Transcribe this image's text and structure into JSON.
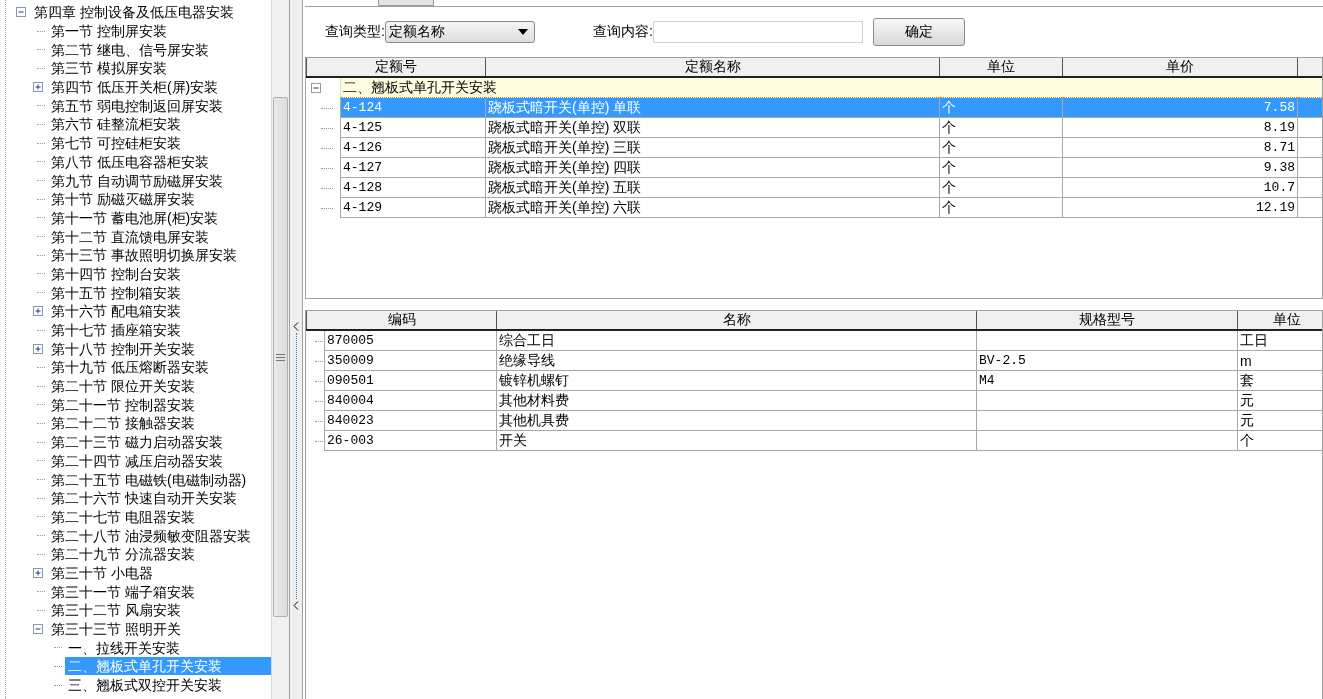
{
  "tree": {
    "items": [
      {
        "label": "第四章 控制设备及低压电器安装",
        "kind": "folder",
        "expanded": true,
        "selected": false,
        "children": [
          {
            "label": "第一节 控制屏安装",
            "kind": "leaf",
            "selected": false
          },
          {
            "label": "第二节 继电、信号屏安装",
            "kind": "leaf",
            "selected": false
          },
          {
            "label": "第三节 模拟屏安装",
            "kind": "leaf",
            "selected": false
          },
          {
            "label": "第四节 低压开关柜(屏)安装",
            "kind": "folder",
            "expanded": false,
            "selected": false
          },
          {
            "label": "第五节 弱电控制返回屏安装",
            "kind": "leaf",
            "selected": false
          },
          {
            "label": "第六节 硅整流柜安装",
            "kind": "leaf",
            "selected": false
          },
          {
            "label": "第七节 可控硅柜安装",
            "kind": "leaf",
            "selected": false
          },
          {
            "label": "第八节 低压电容器柜安装",
            "kind": "leaf",
            "selected": false
          },
          {
            "label": "第九节 自动调节励磁屏安装",
            "kind": "leaf",
            "selected": false
          },
          {
            "label": "第十节 励磁灭磁屏安装",
            "kind": "leaf",
            "selected": false
          },
          {
            "label": "第十一节 蓄电池屏(柜)安装",
            "kind": "leaf",
            "selected": false
          },
          {
            "label": "第十二节 直流馈电屏安装",
            "kind": "leaf",
            "selected": false
          },
          {
            "label": "第十三节 事故照明切换屏安装",
            "kind": "leaf",
            "selected": false
          },
          {
            "label": "第十四节 控制台安装",
            "kind": "leaf",
            "selected": false
          },
          {
            "label": "第十五节 控制箱安装",
            "kind": "leaf",
            "selected": false
          },
          {
            "label": "第十六节 配电箱安装",
            "kind": "folder",
            "expanded": false,
            "selected": false
          },
          {
            "label": "第十七节 插座箱安装",
            "kind": "leaf",
            "selected": false
          },
          {
            "label": "第十八节 控制开关安装",
            "kind": "folder",
            "expanded": false,
            "selected": false
          },
          {
            "label": "第十九节 低压熔断器安装",
            "kind": "leaf",
            "selected": false
          },
          {
            "label": "第二十节 限位开关安装",
            "kind": "leaf",
            "selected": false
          },
          {
            "label": "第二十一节 控制器安装",
            "kind": "leaf",
            "selected": false
          },
          {
            "label": "第二十二节 接触器安装",
            "kind": "leaf",
            "selected": false
          },
          {
            "label": "第二十三节 磁力启动器安装",
            "kind": "leaf",
            "selected": false
          },
          {
            "label": "第二十四节 减压启动器安装",
            "kind": "leaf",
            "selected": false
          },
          {
            "label": "第二十五节 电磁铁(电磁制动器)",
            "kind": "leaf",
            "selected": false
          },
          {
            "label": "第二十六节 快速自动开关安装",
            "kind": "leaf",
            "selected": false
          },
          {
            "label": "第二十七节 电阻器安装",
            "kind": "leaf",
            "selected": false
          },
          {
            "label": "第二十八节 油浸频敏变阻器安装",
            "kind": "leaf",
            "selected": false
          },
          {
            "label": "第二十九节 分流器安装",
            "kind": "leaf",
            "selected": false
          },
          {
            "label": "第三十节 小电器",
            "kind": "folder",
            "expanded": false,
            "selected": false
          },
          {
            "label": "第三十一节 端子箱安装",
            "kind": "leaf",
            "selected": false
          },
          {
            "label": "第三十二节 风扇安装",
            "kind": "leaf",
            "selected": false
          },
          {
            "label": "第三十三节 照明开关",
            "kind": "folder",
            "expanded": true,
            "selected": false,
            "children": [
              {
                "label": "一、拉线开关安装",
                "kind": "leaf",
                "selected": false
              },
              {
                "label": "二、翘板式单孔开关安装",
                "kind": "leaf",
                "selected": true
              },
              {
                "label": "三、翘板式双控开关安装",
                "kind": "leaf",
                "selected": false
              }
            ]
          }
        ]
      }
    ]
  },
  "query": {
    "type_label": "查询类型:",
    "type_value": "定额名称",
    "content_label": "查询内容:",
    "confirm_button": "确定"
  },
  "quota_table": {
    "columns": [
      "定额号",
      "定额名称",
      "单位",
      "单价"
    ],
    "group": {
      "label": "二、翘板式单孔开关安装",
      "expanded": true
    },
    "rows": [
      {
        "code": "4-124",
        "name": "跷板式暗开关(单控) 单联",
        "unit": "个",
        "price": "7.58",
        "selected": true
      },
      {
        "code": "4-125",
        "name": "跷板式暗开关(单控) 双联",
        "unit": "个",
        "price": "8.19",
        "selected": false
      },
      {
        "code": "4-126",
        "name": "跷板式暗开关(单控) 三联",
        "unit": "个",
        "price": "8.71",
        "selected": false
      },
      {
        "code": "4-127",
        "name": "跷板式暗开关(单控) 四联",
        "unit": "个",
        "price": "9.38",
        "selected": false
      },
      {
        "code": "4-128",
        "name": "跷板式暗开关(单控) 五联",
        "unit": "个",
        "price": "10.7",
        "selected": false
      },
      {
        "code": "4-129",
        "name": "跷板式暗开关(单控) 六联",
        "unit": "个",
        "price": "12.19",
        "selected": false
      }
    ]
  },
  "material_table": {
    "columns": [
      "编码",
      "名称",
      "规格型号",
      "单位"
    ],
    "rows": [
      {
        "code": "870005",
        "name": "综合工日",
        "unit": "工日"
      },
      {
        "code": "350009",
        "name": "绝缘导线",
        "spec": "BV-2.5",
        "unit": "m"
      },
      {
        "code": "090501",
        "name": "镀锌机螺钉",
        "spec": "M4",
        "unit": "套"
      },
      {
        "code": "840004",
        "name": "其他材料费",
        "unit": "元"
      },
      {
        "code": "840023",
        "name": "其他机具费",
        "unit": "元"
      },
      {
        "code": "26-003",
        "name": "开关",
        "unit": "个"
      }
    ]
  }
}
